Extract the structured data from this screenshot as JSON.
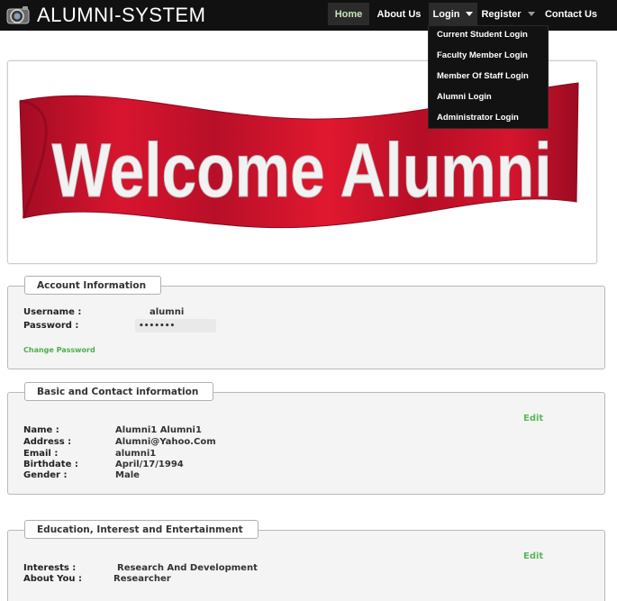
{
  "navbar": {
    "brand": "ALUMNI-SYSTEM",
    "items": [
      {
        "label": "Home"
      },
      {
        "label": "About Us"
      },
      {
        "label": "Login"
      },
      {
        "label": "Register"
      },
      {
        "label": "Contact Us"
      }
    ]
  },
  "login_dropdown": {
    "items": [
      {
        "label": "Current Student Login"
      },
      {
        "label": "Faculty Member Login"
      },
      {
        "label": "Member Of Staff Login"
      },
      {
        "label": "Alumni Login"
      },
      {
        "label": "Administrator Login"
      }
    ]
  },
  "banner": {
    "text": "Welcome Alumni",
    "banner_color": "#c8102e"
  },
  "account": {
    "title": "Account Information",
    "username_label": "Username :",
    "username": "alumni",
    "password_label": "Password :",
    "password": "•••••••",
    "change_password": "Change Password"
  },
  "basic": {
    "title": "Basic and Contact information",
    "edit": "Edit",
    "name_label": "Name :",
    "name": "Alumni1 Alumni1",
    "address_label": "Address :",
    "address": "Alumni@Yahoo.Com",
    "email_label": "Email :",
    "email": "alumni1",
    "birthdate_label": "Birthdate :",
    "birthdate": "April/17/1994",
    "gender_label": "Gender :",
    "gender": "Male"
  },
  "education": {
    "title": "Education, Interest and Entertainment",
    "edit": "Edit",
    "interests_label": "Interests :",
    "interests": "Research And Development",
    "about_label": "About You :",
    "about": "Researcher"
  },
  "colors": {
    "navbar": "#111111",
    "accent_green": "#5cb85c",
    "panel": "#f4f4f4"
  }
}
